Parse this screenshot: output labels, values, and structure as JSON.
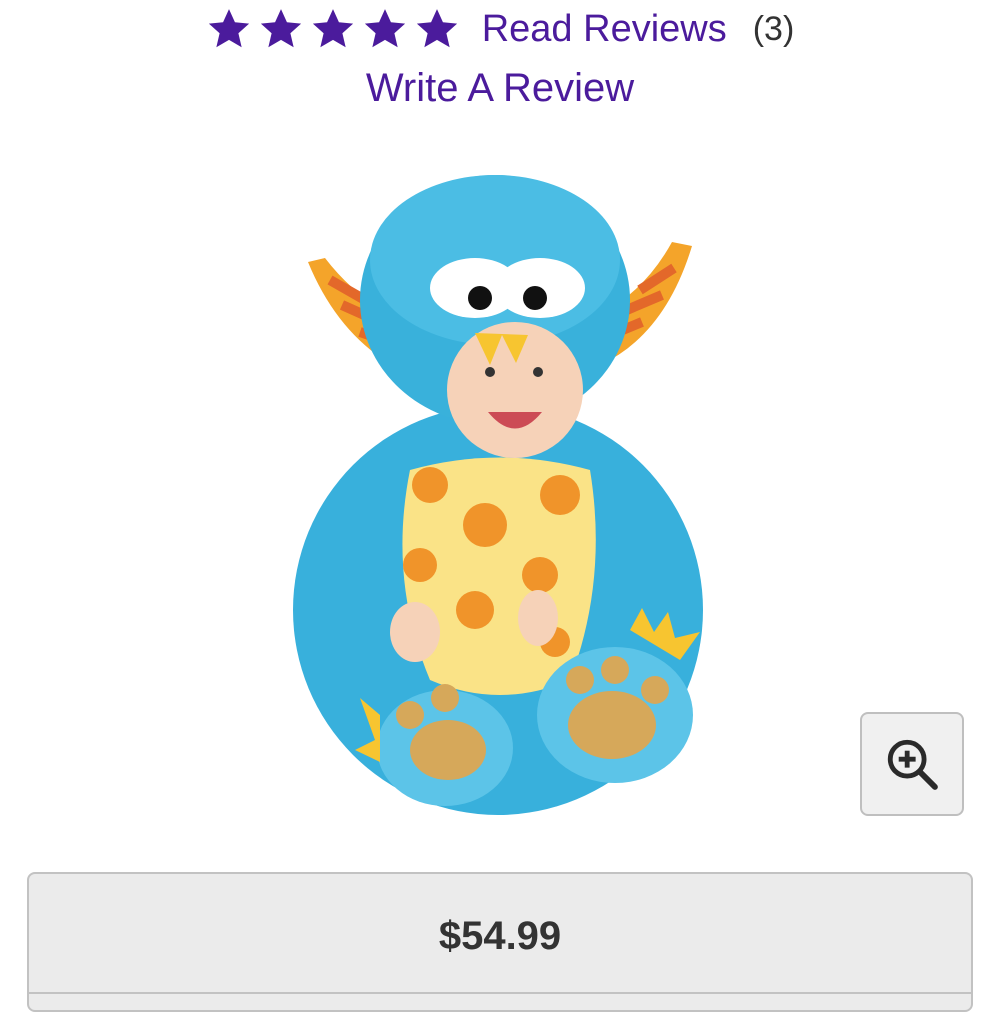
{
  "rating": {
    "star_count": 5,
    "star_color": "#4b1b9c",
    "read_reviews_label": "Read Reviews",
    "review_count": "(3)"
  },
  "write_review_label": "Write A Review",
  "product": {
    "image_subject": "baby in blue furry monster costume with orange striped horns and yellow spotted belly",
    "zoom_icon": "zoom-in-icon"
  },
  "price": {
    "value": "$54.99"
  }
}
